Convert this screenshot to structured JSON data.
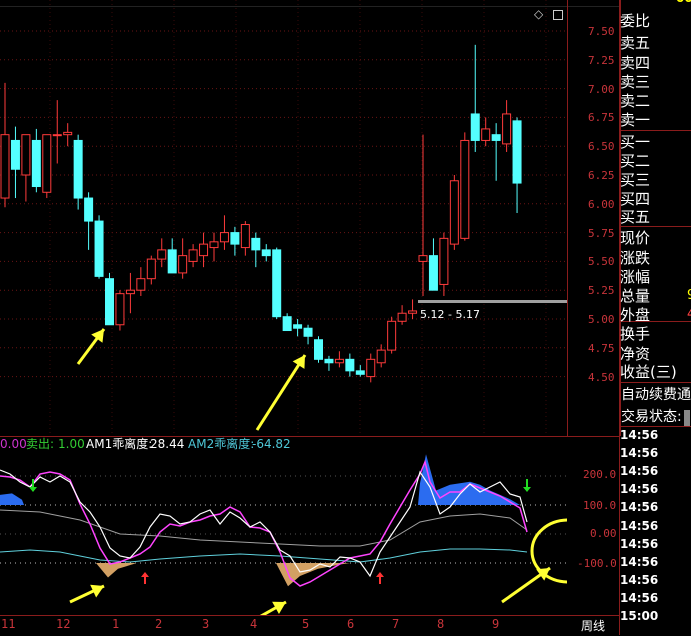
{
  "top_bar": {
    "partial_value": "000"
  },
  "chart_controls": {
    "icon1": "diamond-icon",
    "icon2": "square-icon"
  },
  "price_axis": [
    "7.50",
    "7.25",
    "7.00",
    "6.75",
    "6.50",
    "6.25",
    "6.00",
    "5.75",
    "5.50",
    "5.25",
    "5.00",
    "4.75",
    "4.50"
  ],
  "range_label": "5.12 - 5.17",
  "indicator": {
    "partial": "0.00",
    "sell_label": "卖出:",
    "sell_value": "1.00",
    "am1_label": "AM1乖离度:",
    "am1_value": "28.44",
    "am2_label": "AM2乖离度:",
    "am2_value": "-64.82",
    "axis": [
      "200.0",
      "100.0",
      "0.00",
      "-100.0"
    ]
  },
  "x_axis": [
    "11",
    "12",
    "1",
    "2",
    "3",
    "4",
    "5",
    "6",
    "7",
    "8",
    "9"
  ],
  "period_label": "周线",
  "right_panel": {
    "rows": [
      {
        "label": "委比",
        "value": ""
      },
      {
        "label": "卖五",
        "value": ""
      },
      {
        "label": "卖四",
        "value": ""
      },
      {
        "label": "卖三",
        "value": ""
      },
      {
        "label": "卖二",
        "value": ""
      },
      {
        "label": "卖一",
        "value": ""
      },
      {
        "label": "买一",
        "value": ""
      },
      {
        "label": "买二",
        "value": ""
      },
      {
        "label": "买三",
        "value": ""
      },
      {
        "label": "买四",
        "value": ""
      },
      {
        "label": "买五",
        "value": ""
      },
      {
        "label": "现价",
        "value": ""
      },
      {
        "label": "涨跌",
        "value": ""
      },
      {
        "label": "涨幅",
        "value": ""
      },
      {
        "label": "总量",
        "value": "9"
      },
      {
        "label": "外盘",
        "value": "4"
      },
      {
        "label": "换手",
        "value": ""
      },
      {
        "label": "净资",
        "value": ""
      },
      {
        "label": "收益(三)",
        "value": ""
      }
    ],
    "auto_fee": "自动续费通",
    "trade_status": "交易状态:",
    "times": [
      "14:56",
      "14:56",
      "14:56",
      "14:56",
      "14:56",
      "14:56",
      "14:56",
      "14:56",
      "14:56",
      "14:56",
      "15:00"
    ]
  },
  "candles": [
    {
      "o": 6.05,
      "h": 7.05,
      "l": 5.97,
      "c": 6.6
    },
    {
      "o": 6.55,
      "h": 6.67,
      "l": 6.05,
      "c": 6.3
    },
    {
      "o": 6.25,
      "h": 6.6,
      "l": 6.02,
      "c": 6.6
    },
    {
      "o": 6.55,
      "h": 6.65,
      "l": 6.1,
      "c": 6.15
    },
    {
      "o": 6.1,
      "h": 6.6,
      "l": 6.05,
      "c": 6.6
    },
    {
      "o": 6.6,
      "h": 6.9,
      "l": 6.35,
      "c": 6.6
    },
    {
      "o": 6.6,
      "h": 6.7,
      "l": 6.5,
      "c": 6.62
    },
    {
      "o": 6.55,
      "h": 6.6,
      "l": 5.95,
      "c": 6.05
    },
    {
      "o": 6.05,
      "h": 6.1,
      "l": 5.6,
      "c": 5.85
    },
    {
      "o": 5.85,
      "h": 5.9,
      "l": 5.35,
      "c": 5.37
    },
    {
      "o": 5.35,
      "h": 5.4,
      "l": 4.95,
      "c": 4.95
    },
    {
      "o": 4.95,
      "h": 5.25,
      "l": 4.9,
      "c": 5.22
    },
    {
      "o": 5.22,
      "h": 5.4,
      "l": 5.05,
      "c": 5.25
    },
    {
      "o": 5.25,
      "h": 5.45,
      "l": 5.2,
      "c": 5.35
    },
    {
      "o": 5.35,
      "h": 5.55,
      "l": 5.3,
      "c": 5.52
    },
    {
      "o": 5.52,
      "h": 5.7,
      "l": 5.45,
      "c": 5.6
    },
    {
      "o": 5.6,
      "h": 5.7,
      "l": 5.4,
      "c": 5.4
    },
    {
      "o": 5.4,
      "h": 5.7,
      "l": 5.35,
      "c": 5.55
    },
    {
      "o": 5.5,
      "h": 5.65,
      "l": 5.45,
      "c": 5.6
    },
    {
      "o": 5.55,
      "h": 5.75,
      "l": 5.45,
      "c": 5.65
    },
    {
      "o": 5.62,
      "h": 5.75,
      "l": 5.5,
      "c": 5.67
    },
    {
      "o": 5.67,
      "h": 5.9,
      "l": 5.6,
      "c": 5.75
    },
    {
      "o": 5.75,
      "h": 5.8,
      "l": 5.55,
      "c": 5.65
    },
    {
      "o": 5.62,
      "h": 5.85,
      "l": 5.55,
      "c": 5.82
    },
    {
      "o": 5.7,
      "h": 5.75,
      "l": 5.45,
      "c": 5.6
    },
    {
      "o": 5.6,
      "h": 5.65,
      "l": 5.5,
      "c": 5.55
    },
    {
      "o": 5.6,
      "h": 5.62,
      "l": 5.0,
      "c": 5.02
    },
    {
      "o": 5.02,
      "h": 5.05,
      "l": 4.9,
      "c": 4.9
    },
    {
      "o": 4.95,
      "h": 5.0,
      "l": 4.85,
      "c": 4.92
    },
    {
      "o": 4.92,
      "h": 4.95,
      "l": 4.78,
      "c": 4.85
    },
    {
      "o": 4.82,
      "h": 4.85,
      "l": 4.62,
      "c": 4.65
    },
    {
      "o": 4.65,
      "h": 4.68,
      "l": 4.55,
      "c": 4.62
    },
    {
      "o": 4.62,
      "h": 4.72,
      "l": 4.58,
      "c": 4.65
    },
    {
      "o": 4.65,
      "h": 4.7,
      "l": 4.5,
      "c": 4.55
    },
    {
      "o": 4.55,
      "h": 4.6,
      "l": 4.5,
      "c": 4.52
    },
    {
      "o": 4.5,
      "h": 4.7,
      "l": 4.45,
      "c": 4.65
    },
    {
      "o": 4.62,
      "h": 4.78,
      "l": 4.58,
      "c": 4.73
    },
    {
      "o": 4.73,
      "h": 5.02,
      "l": 4.7,
      "c": 4.98
    },
    {
      "o": 4.98,
      "h": 5.12,
      "l": 4.95,
      "c": 5.05
    },
    {
      "o": 5.05,
      "h": 5.17,
      "l": 5.0,
      "c": 5.07
    },
    {
      "o": 5.5,
      "h": 6.6,
      "l": 5.2,
      "c": 5.55
    },
    {
      "o": 5.55,
      "h": 5.7,
      "l": 5.25,
      "c": 5.25
    },
    {
      "o": 5.3,
      "h": 5.75,
      "l": 5.2,
      "c": 5.7
    },
    {
      "o": 5.65,
      "h": 6.25,
      "l": 5.6,
      "c": 6.2
    },
    {
      "o": 5.7,
      "h": 6.62,
      "l": 5.68,
      "c": 6.55
    },
    {
      "o": 6.78,
      "h": 7.38,
      "l": 6.45,
      "c": 6.55
    },
    {
      "o": 6.55,
      "h": 6.75,
      "l": 6.5,
      "c": 6.65
    },
    {
      "o": 6.6,
      "h": 6.7,
      "l": 6.2,
      "c": 6.55
    },
    {
      "o": 6.52,
      "h": 6.9,
      "l": 6.45,
      "c": 6.78
    },
    {
      "o": 6.72,
      "h": 6.75,
      "l": 5.92,
      "c": 6.18
    }
  ]
}
